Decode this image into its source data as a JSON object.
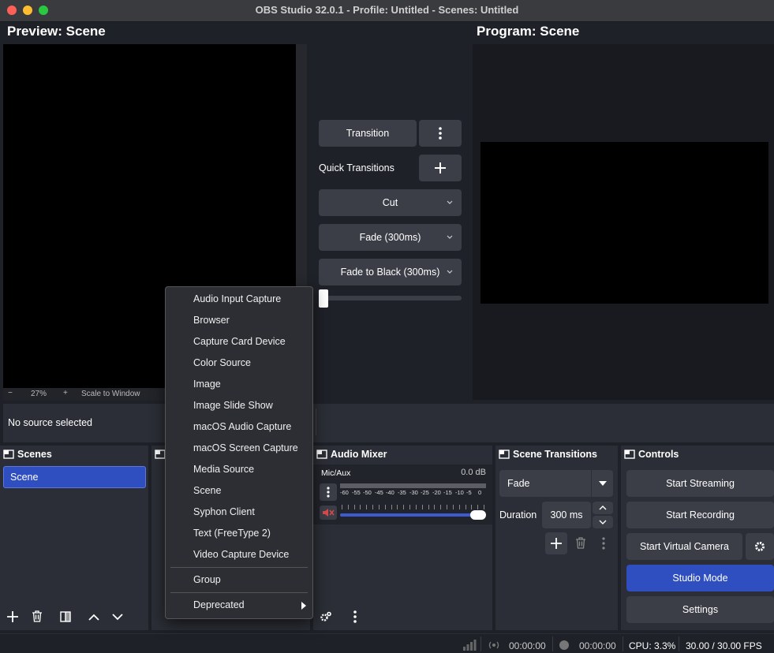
{
  "window": {
    "title": "OBS Studio 32.0.1 - Profile: Untitled - Scenes: Untitled"
  },
  "preview": {
    "label": "Preview: Scene",
    "zoom": "27%",
    "scale_mode": "Scale to Window",
    "zoom_minus": "−",
    "zoom_plus": "+"
  },
  "program": {
    "label": "Program: Scene"
  },
  "transitions_center": {
    "transition_button": "Transition",
    "quick_transitions_label": "Quick Transitions",
    "items": [
      "Cut",
      "Fade (300ms)",
      "Fade to Black (300ms)"
    ],
    "tbar_value": 0
  },
  "source_bar": {
    "status": "No source selected"
  },
  "scenes": {
    "title": "Scenes",
    "items": [
      "Scene"
    ]
  },
  "context_menu": {
    "items": [
      "Audio Input Capture",
      "Browser",
      "Capture Card Device",
      "Color Source",
      "Image",
      "Image Slide Show",
      "macOS Audio Capture",
      "macOS Screen Capture",
      "Media Source",
      "Scene",
      "Syphon Client",
      "Text (FreeType 2)",
      "Video Capture Device"
    ],
    "group": "Group",
    "deprecated": "Deprecated"
  },
  "audio_mixer": {
    "title": "Audio Mixer",
    "channel": {
      "name": "Mic/Aux",
      "level": "0.0 dB",
      "muted": true,
      "volume": 1.0
    },
    "scale": [
      "-60",
      "-55",
      "-50",
      "-45",
      "-40",
      "-35",
      "-30",
      "-25",
      "-20",
      "-15",
      "-10",
      "-5",
      "0"
    ]
  },
  "scene_transitions": {
    "title": "Scene Transitions",
    "selected": "Fade",
    "duration_label": "Duration",
    "duration_value": "300 ms"
  },
  "controls": {
    "title": "Controls",
    "start_streaming": "Start Streaming",
    "start_recording": "Start Recording",
    "start_virtual_camera": "Start Virtual Camera",
    "studio_mode": "Studio Mode",
    "settings": "Settings"
  },
  "status_bar": {
    "stream_time": "00:00:00",
    "record_time": "00:00:00",
    "cpu": "CPU: 3.3%",
    "fps": "30.00 / 30.00 FPS"
  },
  "colors": {
    "accent": "#2f4fc0",
    "close": "#fe5f57",
    "minimize": "#febc2e",
    "maximize": "#28c840",
    "mute": "#d84a4a"
  }
}
